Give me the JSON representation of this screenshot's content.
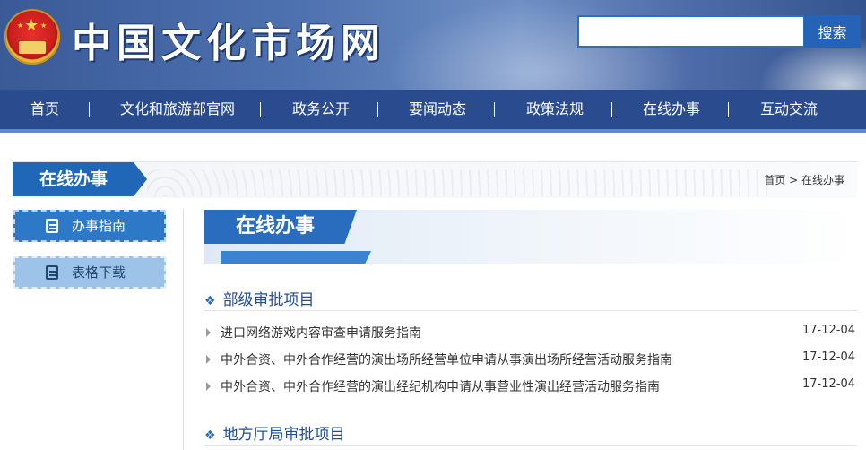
{
  "header": {
    "site_title": "中国文化市场网",
    "search_placeholder": "",
    "search_button": "搜索"
  },
  "nav": {
    "items": [
      "首页",
      "文化和旅游部官网",
      "政务公开",
      "要闻动态",
      "政策法规",
      "在线办事",
      "互动交流"
    ]
  },
  "section": {
    "title": "在线办事",
    "breadcrumb": "首页 > 在线办事"
  },
  "sidebar": {
    "items": [
      {
        "label": "办事指南",
        "icon": "edit-document-icon",
        "active": true
      },
      {
        "label": "表格下载",
        "icon": "form-list-icon",
        "active": false
      }
    ]
  },
  "content": {
    "banner_title": "在线办事",
    "categories": [
      {
        "title": "部级审批项目",
        "items": [
          {
            "title": "进口网络游戏内容审查申请服务指南",
            "date": "17-12-04"
          },
          {
            "title": "中外合资、中外合作经营的演出场所经营单位申请从事演出场所经营活动服务指南",
            "date": "17-12-04"
          },
          {
            "title": "中外合资、中外合作经营的演出经纪机构申请从事营业性演出经营活动服务指南",
            "date": "17-12-04"
          }
        ]
      },
      {
        "title": "地方厅局审批项目",
        "items": []
      }
    ]
  },
  "colors": {
    "header_blue": "#3a5a97",
    "nav_blue": "#2a4c8f",
    "accent_blue": "#2067b8",
    "sidebar_active": "#2e78c8",
    "sidebar_idle": "#9ec3e8"
  }
}
